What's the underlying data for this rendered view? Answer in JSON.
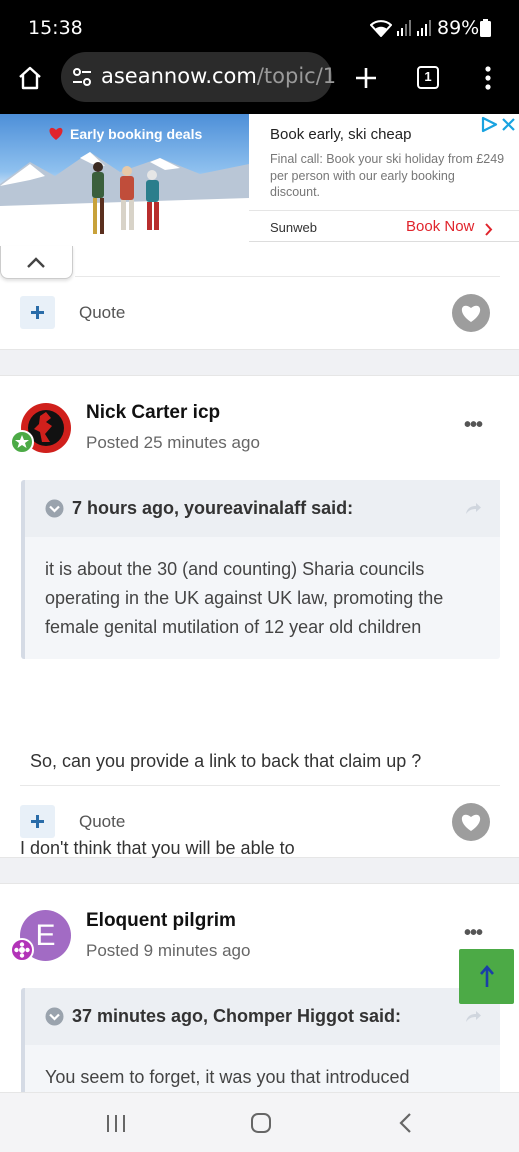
{
  "status_bar": {
    "time": "15:38",
    "battery": "89%"
  },
  "browser": {
    "url_host": "aseannow.com",
    "url_path": "/topic/1",
    "tab_count": "1"
  },
  "ad": {
    "promo": "Early booking deals",
    "headline": "Book early, ski cheap",
    "body": "Final call: Book your ski holiday from £249 per person with our early booking discount.",
    "advertiser": "Sunweb",
    "cta": "Book Now"
  },
  "labels": {
    "quote": "Quote"
  },
  "posts": [
    {
      "author": "Nick Carter icp",
      "posted": "Posted 25 minutes ago",
      "quote_by": "7 hours ago, youreavinalaff said:",
      "quote_lines": [
        "it is about the 30 (and counting) Sharia councils",
        "operating in the UK against UK law, promoting the",
        "female genital mutilation of 12 year old children"
      ],
      "body_lines": [
        "  So, can you provide a link to back that claim up ?",
        "I don't think that you will be able to"
      ]
    },
    {
      "author": "Eloquent pilgrim",
      "avatar_letter": "E",
      "posted": "Posted 9 minutes ago",
      "quote_by": "37 minutes ago, Chomper Higgot said:",
      "quote_lines": [
        "You seem to forget, it was you that introduced"
      ]
    }
  ],
  "colors": {
    "accent_blue": "#2a6ca8",
    "heart_gray": "#9d9d9d",
    "scroll_top_green": "#4caa46",
    "ad_cta_red": "#e0242c"
  },
  "icons": [
    "home-icon",
    "tune-icon",
    "new-tab-icon",
    "tab-switcher-icon",
    "overflow-menu-icon",
    "wifi-icon",
    "signal-icon",
    "battery-icon",
    "heart-icon",
    "plus-icon",
    "chevron-up-icon",
    "adchoices-icon",
    "close-icon",
    "share-icon",
    "arrow-up-icon",
    "recents-icon",
    "home-nav-icon",
    "back-icon"
  ]
}
